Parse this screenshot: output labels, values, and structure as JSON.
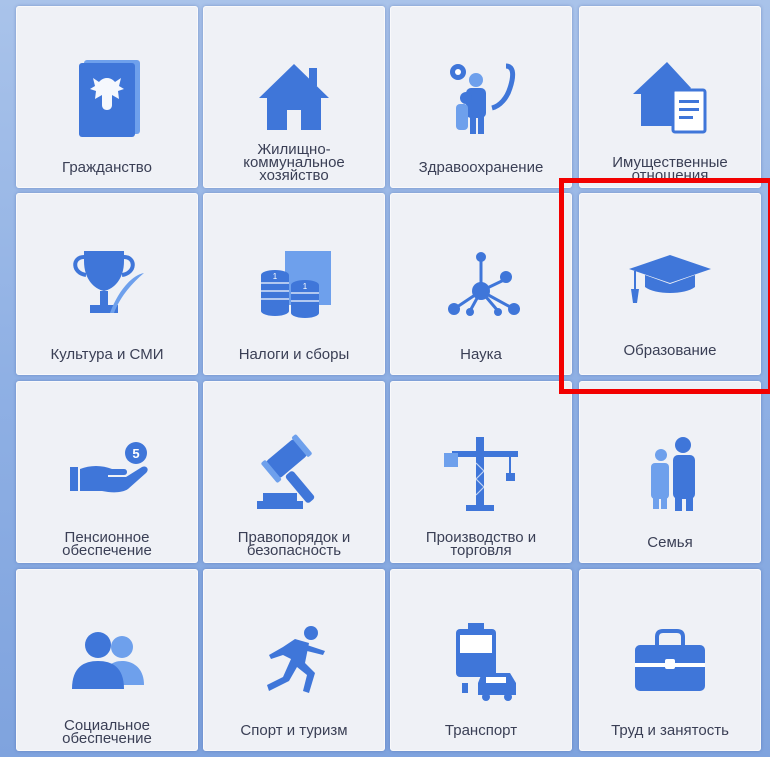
{
  "tiles": [
    {
      "label": "Гражданство",
      "icon": "passport-icon"
    },
    {
      "label": "Жилищно-\nкоммунальное\nхозяйство",
      "icon": "house-icon"
    },
    {
      "label": "Здравоохранение",
      "icon": "stethoscope-icon"
    },
    {
      "label": "Имущественные\nотношения",
      "icon": "house-document-icon"
    },
    {
      "label": "Культура и СМИ",
      "icon": "trophy-quill-icon"
    },
    {
      "label": "Налоги и сборы",
      "icon": "coins-icon"
    },
    {
      "label": "Наука",
      "icon": "molecule-icon"
    },
    {
      "label": "Образование",
      "icon": "graduation-cap-icon"
    },
    {
      "label": "Пенсионное\nобеспечение",
      "icon": "hand-coin-icon"
    },
    {
      "label": "Правопорядок и\nбезопасность",
      "icon": "gavel-icon"
    },
    {
      "label": "Производство и\nторговля",
      "icon": "crane-icon"
    },
    {
      "label": "Семья",
      "icon": "family-icon"
    },
    {
      "label": "Социальное\nобеспечение",
      "icon": "people-icon"
    },
    {
      "label": "Спорт и туризм",
      "icon": "runner-icon"
    },
    {
      "label": "Транспорт",
      "icon": "transport-icon"
    },
    {
      "label": "Труд и занятость",
      "icon": "briefcase-icon"
    }
  ],
  "selected_tile": "Образование",
  "colors": {
    "icon": "#3f76d9",
    "highlight": "#f20000",
    "tile_bg": "#eff1f6"
  }
}
